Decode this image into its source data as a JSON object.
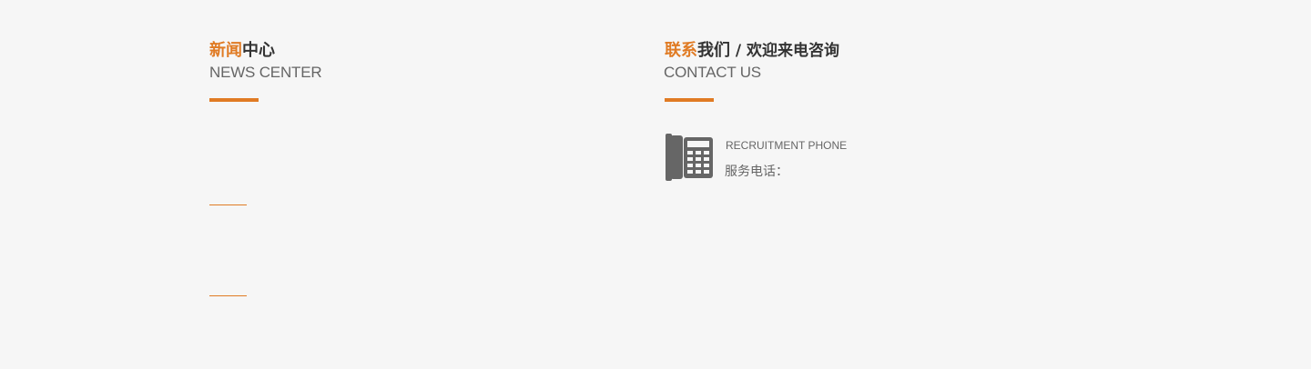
{
  "news": {
    "title_accent": "新闻",
    "title_rest": "中心",
    "subtitle": "NEWS CENTER"
  },
  "contact": {
    "title_accent": "联系",
    "title_rest": "我们",
    "title_extra": " / 欢迎来电咨询",
    "subtitle": "CONTACT US",
    "phone_label": "RECRUITMENT PHONE",
    "phone_prefix": "服务电话：",
    "phone_icon": "telephone-icon"
  },
  "colors": {
    "accent": "#e07b24",
    "dark_text": "#333333",
    "muted_text": "#666666",
    "background": "#f6f6f6"
  }
}
